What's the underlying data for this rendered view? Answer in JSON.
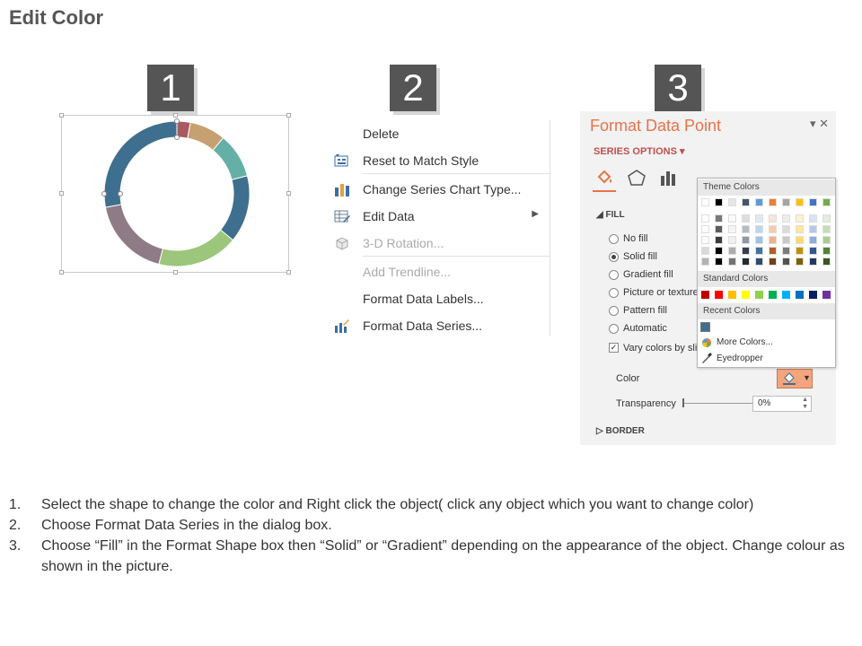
{
  "page": {
    "title": "Edit Color"
  },
  "steps": [
    "1",
    "2",
    "3"
  ],
  "chart_data": {
    "type": "pie",
    "style": "doughnut",
    "values": [
      3,
      8,
      10,
      15,
      18,
      18,
      28
    ],
    "colors": [
      "#a85a61",
      "#c6a071",
      "#64b0a6",
      "#3f6f8e",
      "#9bc67b",
      "#8e7b86",
      "#3f6f8e"
    ]
  },
  "menu": {
    "items": [
      {
        "label": "Delete",
        "icon": "none",
        "disabled": false
      },
      {
        "label": "Reset to Match Style",
        "icon": "reset-style-icon",
        "disabled": false
      },
      {
        "label": "Change Series Chart Type...",
        "icon": "bar-chart-icon",
        "disabled": false
      },
      {
        "label": "Edit Data",
        "icon": "table-edit-icon",
        "disabled": false,
        "submenu": true
      },
      {
        "label": "3-D Rotation...",
        "icon": "cube-icon",
        "disabled": true
      },
      {
        "label": "Add Trendline...",
        "icon": "none",
        "disabled": true
      },
      {
        "label": "Format Data Labels...",
        "icon": "none",
        "disabled": false
      },
      {
        "label": "Format Data Series...",
        "icon": "format-series-icon",
        "disabled": false
      }
    ]
  },
  "format_pane": {
    "title": "Format Data Point",
    "series_options": "SERIES OPTIONS",
    "fill_header": "FILL",
    "fill_options": [
      "No fill",
      "Solid fill",
      "Gradient fill",
      "Picture or texture",
      "Pattern fill",
      "Automatic"
    ],
    "selected_fill": "Solid fill",
    "vary_colors": "Vary colors by sli",
    "color_label": "Color",
    "transparency_label": "Transparency",
    "transparency_value": "0%",
    "border_header": "BORDER"
  },
  "palette": {
    "theme_colors_label": "Theme Colors",
    "standard_colors_label": "Standard Colors",
    "recent_colors_label": "Recent Colors",
    "more_colors": "More Colors...",
    "eyedropper": "Eyedropper",
    "theme_base": [
      "#ffffff",
      "#000000",
      "#e7e6e6",
      "#44546a",
      "#5b9bd5",
      "#ed7d31",
      "#a5a5a5",
      "#ffc000",
      "#4472c4",
      "#70ad47"
    ],
    "standard": [
      "#c00000",
      "#ff0000",
      "#ffc000",
      "#ffff00",
      "#92d050",
      "#00b050",
      "#00b0f0",
      "#0070c0",
      "#002060",
      "#7030a0"
    ],
    "recent": [
      "#3f6f8e"
    ]
  },
  "instructions": [
    {
      "num": "1.",
      "text": "Select the shape to change the color and Right click the object( click any object which you want to change color)"
    },
    {
      "num": "2.",
      "text": "Choose Format Data Series in the dialog box."
    },
    {
      "num": "3.",
      "text": "Choose “Fill” in the Format Shape box then “Solid” or “Gradient” depending on the appearance of the object. Change colour as shown in the picture."
    }
  ]
}
